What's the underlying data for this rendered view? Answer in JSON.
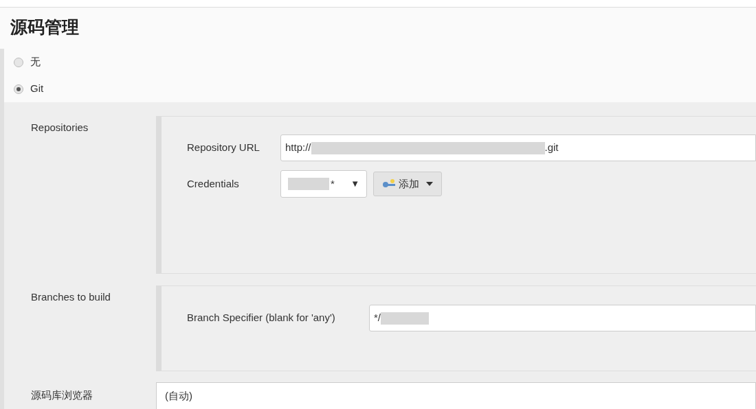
{
  "section_title": "源码管理",
  "scm_options": [
    {
      "label": "无",
      "selected": false
    },
    {
      "label": "Git",
      "selected": true
    }
  ],
  "repositories": {
    "label": "Repositories",
    "url": {
      "label": "Repository URL",
      "value_start": "http://",
      "value_end": ".git"
    },
    "credentials": {
      "label": "Credentials",
      "value_end": "*",
      "arrow": "▼",
      "add_button": "添加"
    }
  },
  "branches": {
    "label": "Branches to build",
    "specifier": {
      "label": "Branch Specifier (blank for 'any')",
      "value_start": "*/"
    }
  },
  "browser": {
    "label": "源码库浏览器",
    "value": "(自动)"
  }
}
